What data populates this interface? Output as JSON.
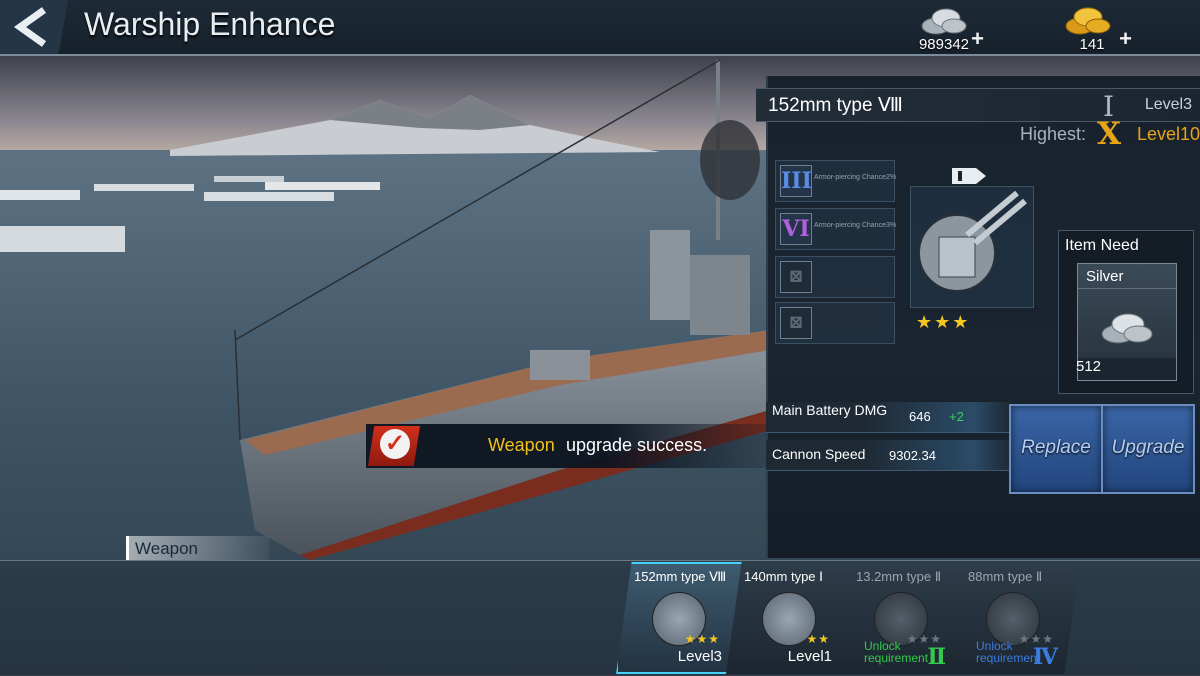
{
  "header": {
    "title": "Warship Enhance",
    "silver_amount": "989342",
    "gold_amount": "141",
    "plus_symbol": "+"
  },
  "weapon_panel": {
    "name": "152mm type Ⅷ",
    "current_roman": "I",
    "current_level": "Level3",
    "highest_label": "Highest:",
    "highest_roman": "X",
    "highest_level": "Level10",
    "star_display": "★★★",
    "slots": [
      {
        "glyph": "III",
        "text": "Armor-piercing Chance2%",
        "color": "#5a8ce6",
        "locked": false
      },
      {
        "glyph": "VI",
        "text": "Armor-piercing Chance3%",
        "color": "#b160e0",
        "locked": false
      },
      {
        "glyph": "⊠",
        "text": "",
        "color": "#5b6873",
        "locked": true
      },
      {
        "glyph": "⊠",
        "text": "",
        "color": "#5b6873",
        "locked": true
      }
    ],
    "item_need": {
      "title": "Item Need",
      "item_name": "Silver",
      "quantity": "512"
    },
    "stats": [
      {
        "label": "Main Battery DMG",
        "value": "646",
        "bonus": "+2"
      },
      {
        "label": "Cannon Speed",
        "value": "9302.34",
        "bonus": ""
      }
    ],
    "replace_label": "Replace",
    "upgrade_label": "Upgrade"
  },
  "toast": {
    "keyword": "Weapon",
    "message": "upgrade success."
  },
  "section_label": "Weapon",
  "weapon_cards": [
    {
      "name": "152mm type Ⅷ",
      "stars": "★★★",
      "level": "Level3",
      "unlock": "",
      "unlock_roman": "",
      "active": true
    },
    {
      "name": "140mm type Ⅰ",
      "stars": "★★",
      "level": "Level1",
      "unlock": "",
      "unlock_roman": "",
      "active": false
    },
    {
      "name": "13.2mm type Ⅱ",
      "stars": "★★★",
      "level": "",
      "unlock": "Unlock requirement",
      "unlock_roman": "Ⅱ",
      "active": false
    },
    {
      "name": "88mm type Ⅱ",
      "stars": "★★★",
      "level": "",
      "unlock": "Unlock requirement",
      "unlock_roman": "Ⅳ",
      "active": false
    }
  ],
  "colors": {
    "accent_gold": "#e6a417",
    "bonus_green": "#35d35a",
    "button_blue": "#2b4f8c"
  }
}
